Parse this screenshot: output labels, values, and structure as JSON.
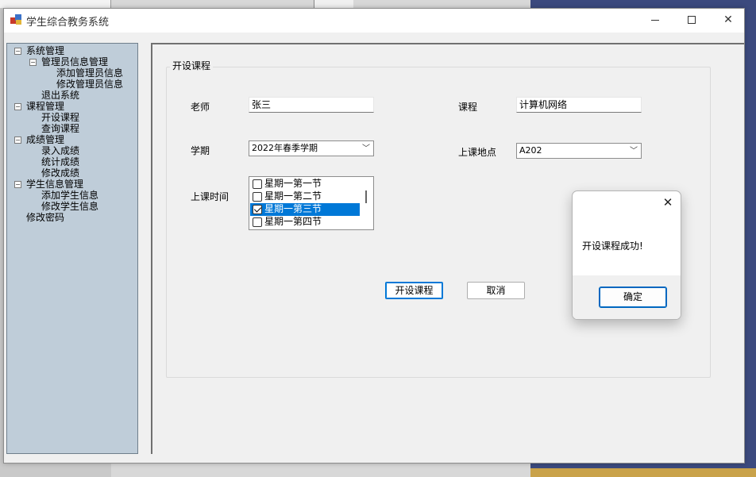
{
  "window": {
    "title": "学生综合教务系统"
  },
  "tree": {
    "nodes": [
      {
        "label": "系统管理",
        "expanded": true
      },
      {
        "label": "管理员信息管理",
        "expanded": true
      },
      {
        "label": "添加管理员信息"
      },
      {
        "label": "修改管理员信息"
      },
      {
        "label": "退出系统"
      },
      {
        "label": "课程管理",
        "expanded": true
      },
      {
        "label": "开设课程"
      },
      {
        "label": "查询课程"
      },
      {
        "label": "成绩管理",
        "expanded": true
      },
      {
        "label": "录入成绩"
      },
      {
        "label": "统计成绩"
      },
      {
        "label": "修改成绩"
      },
      {
        "label": "学生信息管理",
        "expanded": true
      },
      {
        "label": "添加学生信息"
      },
      {
        "label": "修改学生信息"
      },
      {
        "label": "修改密码"
      }
    ]
  },
  "form": {
    "group_title": "开设课程",
    "teacher_label": "老师",
    "teacher_value": "张三",
    "course_label": "课程",
    "course_value": "计算机网络",
    "term_label": "学期",
    "term_value": "2022年春季学期",
    "location_label": "上课地点",
    "location_value": "A202",
    "time_label": "上课时间",
    "time_options": [
      {
        "label": "星期一第一节",
        "checked": false,
        "selected": false
      },
      {
        "label": "星期一第二节",
        "checked": false,
        "selected": false
      },
      {
        "label": "星期一第三节",
        "checked": true,
        "selected": true
      },
      {
        "label": "星期一第四节",
        "checked": false,
        "selected": false
      }
    ],
    "submit_label": "开设课程",
    "cancel_label": "取消"
  },
  "dialog": {
    "message": "开设课程成功!",
    "ok_label": "确定"
  }
}
